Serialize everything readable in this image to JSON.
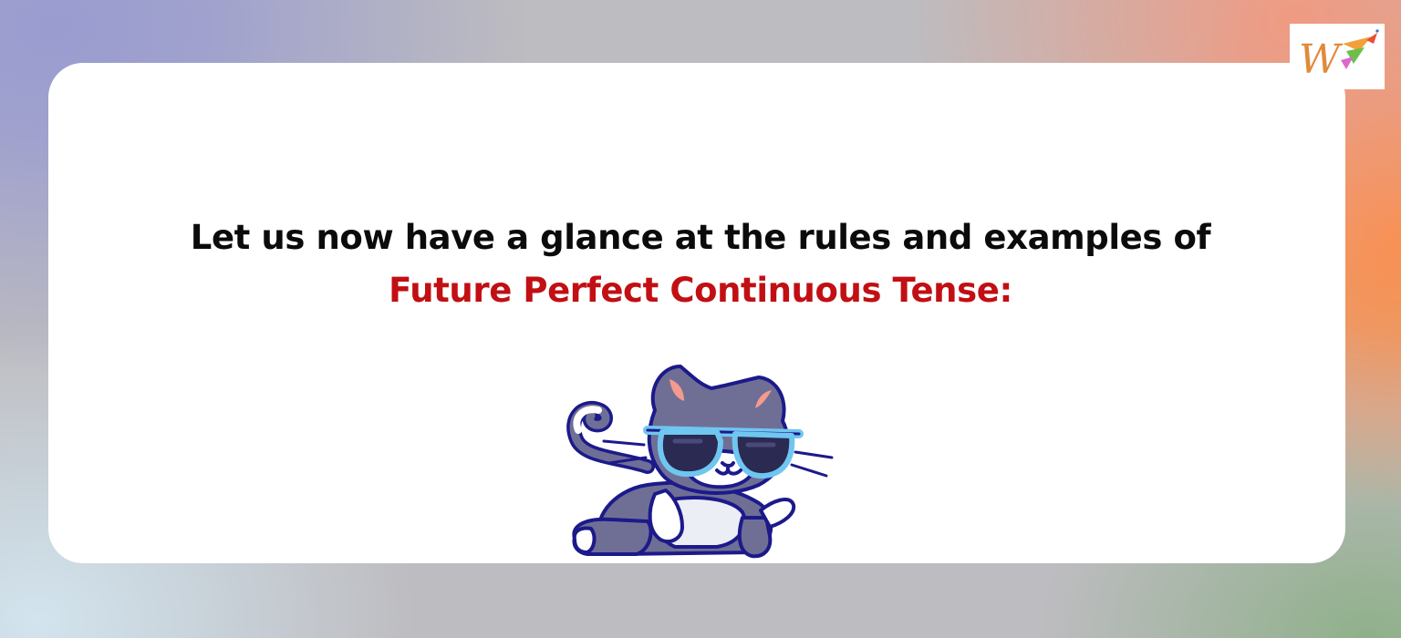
{
  "heading": {
    "line1": "Let us now have a glance at the rules and examples of",
    "line2": "Future Perfect Continuous Tense:"
  },
  "colors": {
    "heading_primary": "#0b0b0b",
    "heading_accent": "#c10f13",
    "card": "#ffffff",
    "cat_body": "#6f6f96",
    "sunglass_frame": "#6fc6f0",
    "outline": "#1c1a8a"
  },
  "logo": {
    "text": "W",
    "icon": "brand-logo"
  },
  "illustration": {
    "icon": "cat-with-sunglasses"
  }
}
